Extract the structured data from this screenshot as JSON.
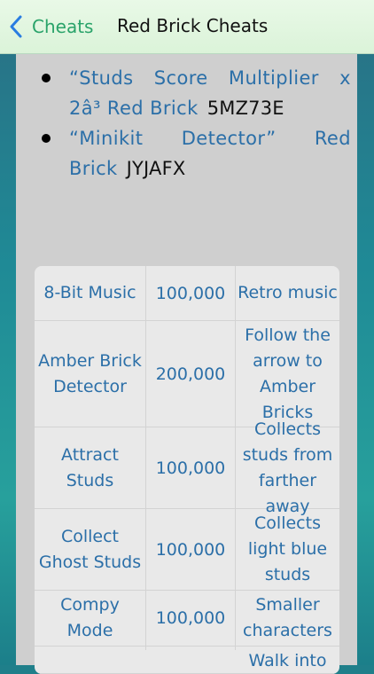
{
  "navbar": {
    "back_label": "Cheats",
    "title": "Red Brick Cheats"
  },
  "bullets": [
    {
      "line1_words": [
        "“Studs",
        "Score",
        "Multiplier",
        "x"
      ],
      "line2_text": "2â³ Red Brick",
      "code": "5MZ73E"
    },
    {
      "line1_words": [
        "“Minikit",
        "Detector”",
        "Red"
      ],
      "line2_text": "Brick",
      "code": "JYJAFX"
    }
  ],
  "table": {
    "rows": [
      {
        "name": "8-Bit Music",
        "value": "100,000",
        "desc": "Retro music"
      },
      {
        "name": "Amber Brick Detector",
        "value": "200,000",
        "desc": "Follow the arrow to Amber Bricks"
      },
      {
        "name": "Attract Studs",
        "value": "100,000",
        "desc": "Collects studs from farther away"
      },
      {
        "name": "Collect Ghost Studs",
        "value": "100,000",
        "desc": "Collects light blue studs"
      },
      {
        "name": "Compy Mode",
        "value": "100,000",
        "desc": "Smaller characters"
      },
      {
        "name": "",
        "value": "",
        "desc": "Walk into"
      }
    ]
  }
}
